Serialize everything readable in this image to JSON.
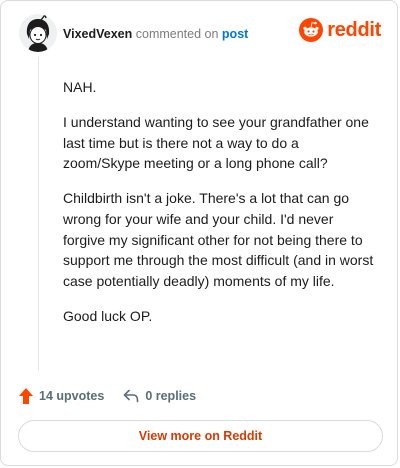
{
  "comment": {
    "username": "VixedVexen",
    "action_text": "commented on",
    "post_link": "post",
    "paragraphs": [
      "NAH.",
      "I understand wanting to see your grandfather one last time but is there not a way to do a zoom/Skype meeting or a long phone call?",
      "Childbirth isn't a joke. There's a lot that can go wrong for your wife and your child. I'd never forgive my significant other for not being there to support me through the most difficult (and in worst case potentially deadly) moments of my life.",
      "Good luck OP."
    ]
  },
  "brand": {
    "name": "reddit",
    "color": "#ff4500"
  },
  "actions": {
    "upvotes": "14 upvotes",
    "replies": "0 replies"
  },
  "footer": {
    "view_more_label": "View more on Reddit"
  },
  "icons": {
    "avatar": "user-avatar",
    "logo": "reddit-alien-icon",
    "upvote": "upvote-arrow-icon",
    "reply": "reply-arrow-icon"
  }
}
